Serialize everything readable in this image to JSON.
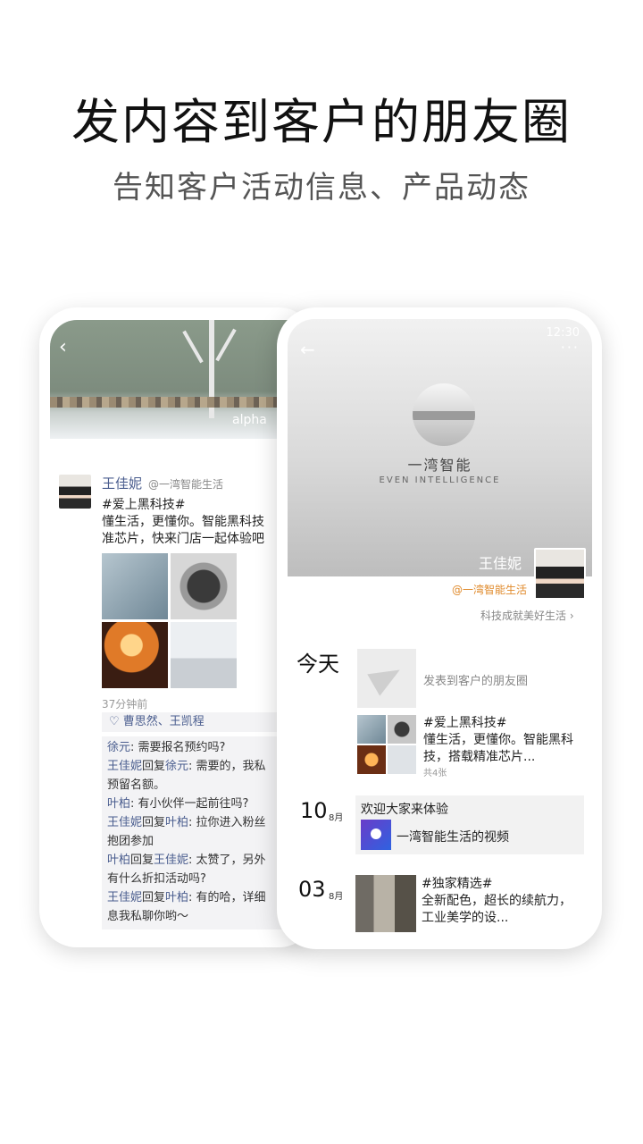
{
  "banner": {
    "headline": "发内容到客户的朋友圈",
    "subline": "告知客户活动信息、产品动态"
  },
  "left_phone": {
    "cover_tag": "alpha",
    "back_icon": "‹",
    "author": "王佳妮",
    "handle": "@一湾智能生活",
    "post_lines": [
      "#爱上黑科技#",
      "懂生活，更懂你。智能黑科技",
      "准芯片，快来门店一起体验吧"
    ],
    "time": "37分钟前",
    "likes": "♡ 曹思然、王凯程",
    "comments": [
      {
        "n1": "徐元",
        "r": "",
        "n2": "",
        "text": ": 需要报名预约吗?"
      },
      {
        "n1": "王佳妮",
        "r": "回复",
        "n2": "徐元",
        "text": ": 需要的，我私"
      },
      {
        "n1": "",
        "r": "",
        "n2": "",
        "text": "预留名额。"
      },
      {
        "n1": "叶柏",
        "r": "",
        "n2": "",
        "text": ": 有小伙伴一起前往吗?"
      },
      {
        "n1": "王佳妮",
        "r": "回复",
        "n2": "叶柏",
        "text": ": 拉你进入粉丝"
      },
      {
        "n1": "",
        "r": "",
        "n2": "",
        "text": "抱团参加"
      },
      {
        "n1": "叶柏",
        "r": "回复",
        "n2": "王佳妮",
        "text": ": 太赞了，另外"
      },
      {
        "n1": "",
        "r": "",
        "n2": "",
        "text": "有什么折扣活动吗?"
      },
      {
        "n1": "王佳妮",
        "r": "回复",
        "n2": "叶柏",
        "text": ": 有的哈，详细"
      },
      {
        "n1": "",
        "r": "",
        "n2": "",
        "text": "息我私聊你哟～"
      }
    ]
  },
  "right_phone": {
    "status_time": "12:30",
    "back_icon": "←",
    "more_icon": "···",
    "brand_cn": "一湾智能",
    "brand_en": "EVEN INTELLIGENCE",
    "name": "王佳妮",
    "handle": "@一湾智能生活",
    "slogan": "科技成就美好生活 ›",
    "today_label": "今天",
    "send_label": "发表到客户的朋友圈",
    "post1_lines": [
      "#爱上黑科技#",
      "懂生活，更懂你。智能黑科",
      "技，搭载精准芯片..."
    ],
    "post1_count": "共4张",
    "entry2": {
      "day": "10",
      "month": "8月",
      "title": "欢迎大家来体验",
      "video_label": "一湾智能生活的视频"
    },
    "entry3": {
      "day": "03",
      "month": "8月",
      "lines": [
        "#独家精选#",
        "全新配色，超长的续航力，",
        "工业美学的设..."
      ]
    }
  }
}
